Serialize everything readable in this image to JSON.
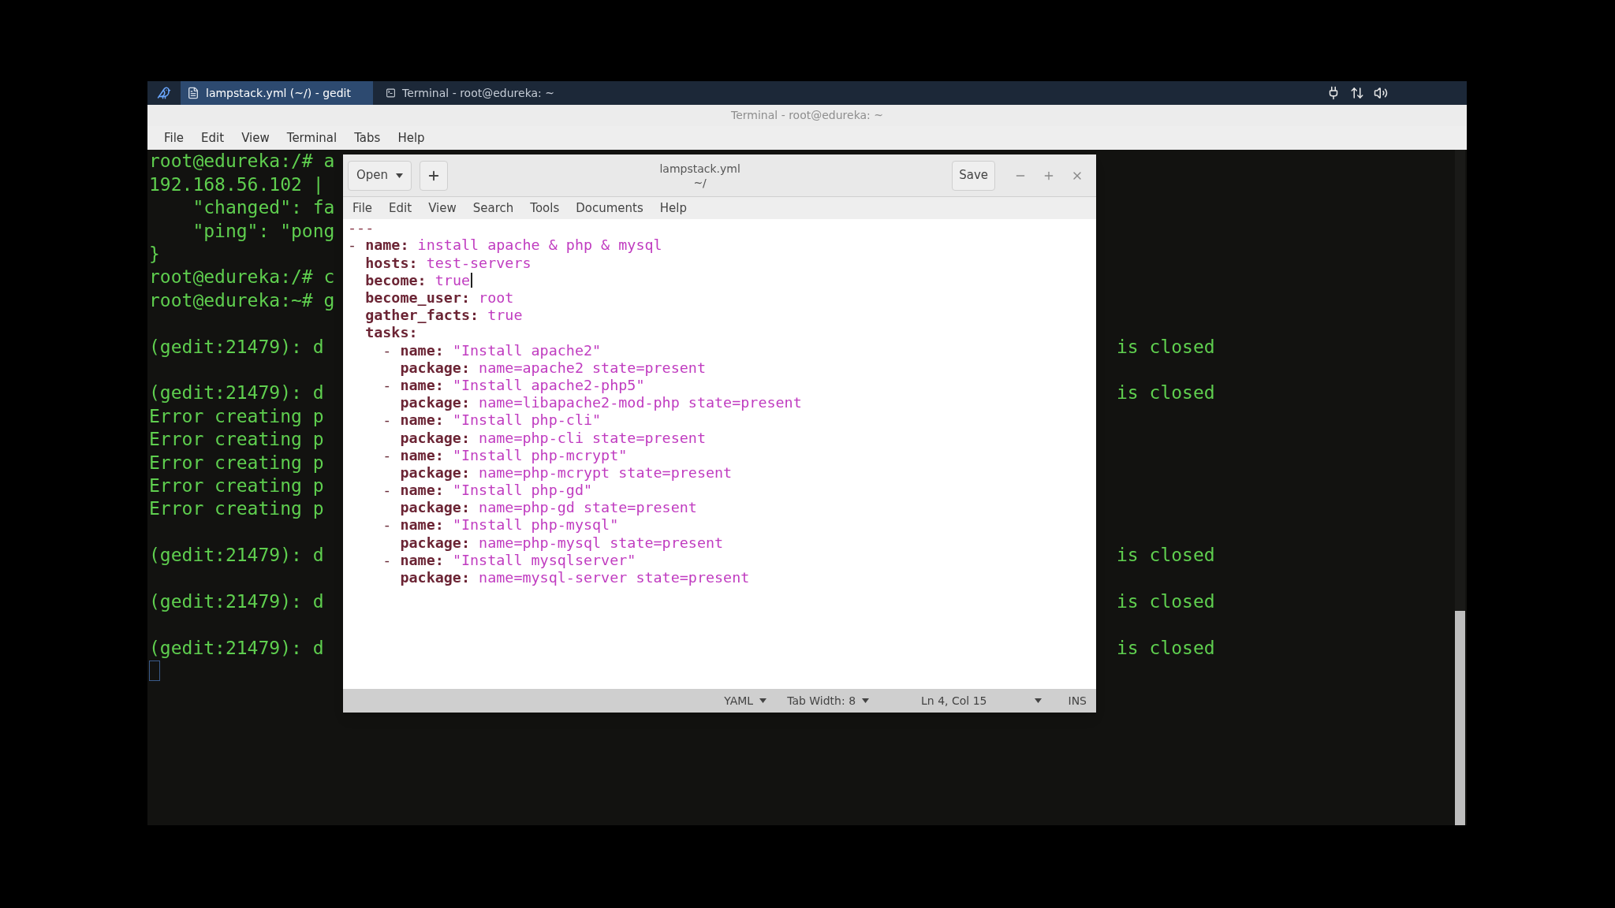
{
  "taskbar": {
    "tasks": [
      {
        "label": "lampstack.yml (~/) - gedit",
        "kind": "editor",
        "selected": true
      },
      {
        "label": "Terminal - root@edureka: ~",
        "kind": "terminal",
        "selected": false
      }
    ]
  },
  "terminal": {
    "title": "Terminal - root@edureka: ~",
    "menu": [
      "File",
      "Edit",
      "View",
      "Terminal",
      "Tabs",
      "Help"
    ],
    "lines": [
      {
        "kind": "text",
        "left": "root@edureka:/# a"
      },
      {
        "kind": "text",
        "left": "192.168.56.102 |"
      },
      {
        "kind": "text",
        "left": "    \"changed\": fa"
      },
      {
        "kind": "text",
        "left": "    \"ping\": \"pong"
      },
      {
        "kind": "text",
        "left": "}"
      },
      {
        "kind": "text",
        "left": "root@edureka:/# c"
      },
      {
        "kind": "text",
        "left": "root@edureka:~# g"
      },
      {
        "kind": "blank"
      },
      {
        "kind": "text",
        "left": "(gedit:21479): d",
        "right": "is closed"
      },
      {
        "kind": "blank"
      },
      {
        "kind": "text",
        "left": "(gedit:21479): d",
        "right": "is closed"
      },
      {
        "kind": "text",
        "left": "Error creating p"
      },
      {
        "kind": "text",
        "left": "Error creating p"
      },
      {
        "kind": "text",
        "left": "Error creating p"
      },
      {
        "kind": "text",
        "left": "Error creating p"
      },
      {
        "kind": "text",
        "left": "Error creating p"
      },
      {
        "kind": "blank"
      },
      {
        "kind": "text",
        "left": "(gedit:21479): d",
        "right": "is closed"
      },
      {
        "kind": "blank"
      },
      {
        "kind": "text",
        "left": "(gedit:21479): d",
        "right": "is closed"
      },
      {
        "kind": "blank"
      },
      {
        "kind": "text",
        "left": "(gedit:21479): d",
        "right": "is closed"
      },
      {
        "kind": "prompt"
      }
    ]
  },
  "gedit": {
    "open_button": "Open",
    "title": "lampstack.yml",
    "subtitle": "~/",
    "save_button": "Save",
    "menu": [
      "File",
      "Edit",
      "View",
      "Search",
      "Tools",
      "Documents",
      "Help"
    ],
    "lines": [
      {
        "text": "---",
        "cursor": false
      },
      {
        "text": "- name: install apache & php & mysql",
        "cursor": false
      },
      {
        "text": "  hosts: test-servers",
        "cursor": false
      },
      {
        "text": "  become: true",
        "cursor": true
      },
      {
        "text": "  become_user: root",
        "cursor": false
      },
      {
        "text": "  gather_facts: true",
        "cursor": false
      },
      {
        "text": "  tasks:",
        "cursor": false
      },
      {
        "text": "    - name: \"Install apache2\"",
        "cursor": false
      },
      {
        "text": "      package: name=apache2 state=present",
        "cursor": false
      },
      {
        "text": "    - name: \"Install apache2-php5\"",
        "cursor": false
      },
      {
        "text": "      package: name=libapache2-mod-php state=present",
        "cursor": false
      },
      {
        "text": "    - name: \"Install php-cli\"",
        "cursor": false
      },
      {
        "text": "      package: name=php-cli state=present",
        "cursor": false
      },
      {
        "text": "    - name: \"Install php-mcrypt\"",
        "cursor": false
      },
      {
        "text": "      package: name=php-mcrypt state=present",
        "cursor": false
      },
      {
        "text": "    - name: \"Install php-gd\"",
        "cursor": false
      },
      {
        "text": "      package: name=php-gd state=present",
        "cursor": false
      },
      {
        "text": "    - name: \"Install php-mysql\"",
        "cursor": false
      },
      {
        "text": "      package: name=php-mysql state=present",
        "cursor": false
      },
      {
        "text": "    - name: \"Install mysqlserver\"",
        "cursor": false
      },
      {
        "text": "      package: name=mysql-server state=present",
        "cursor": false
      }
    ],
    "status": {
      "language": "YAML",
      "tab_width": "Tab Width: 8",
      "position": "Ln 4, Col 15",
      "mode": "INS"
    }
  }
}
